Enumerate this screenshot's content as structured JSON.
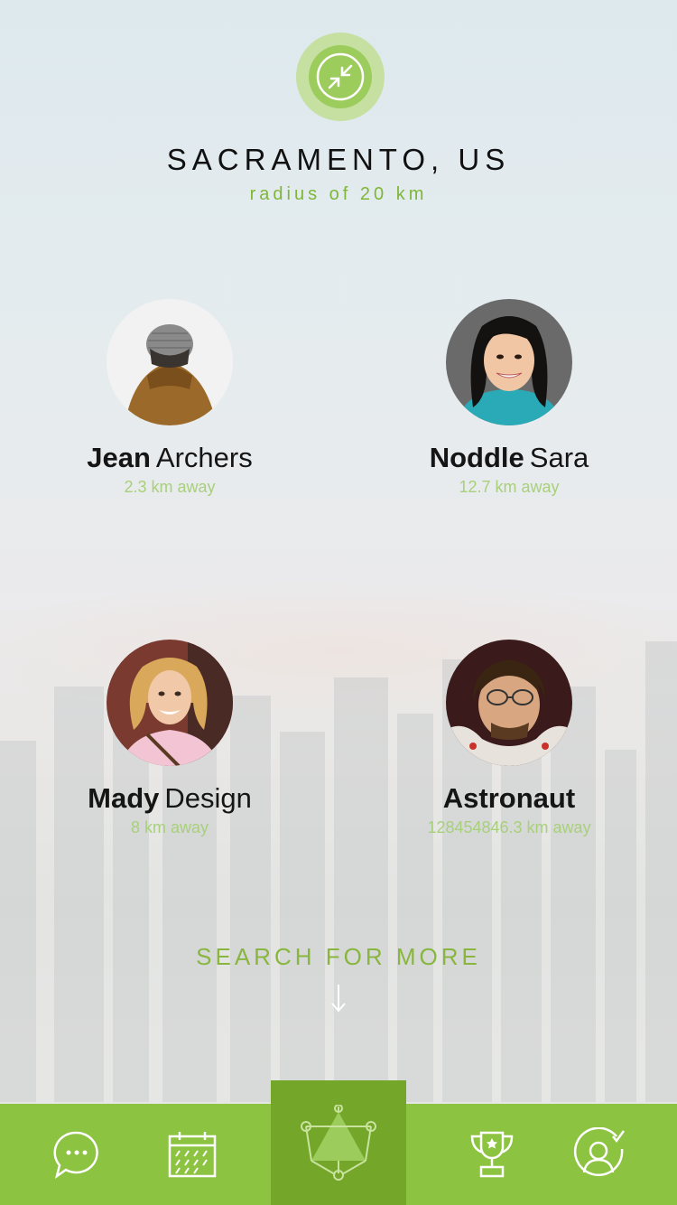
{
  "location": {
    "city": "SACRAMENTO, US",
    "radius": "radius of 20 km"
  },
  "people": [
    {
      "first": "Jean",
      "last": "Archers",
      "distance": "2.3 km away"
    },
    {
      "first": "Noddle",
      "last": "Sara",
      "distance": "12.7 km away"
    },
    {
      "first": "Mady",
      "last": "Design",
      "distance": "8 km away"
    },
    {
      "first": "Astronaut",
      "last": "",
      "distance": "128454846.3 km away"
    }
  ],
  "search_more": "SEARCH FOR MORE",
  "tabbar": {
    "items": [
      {
        "icon": "chat-bubble-icon"
      },
      {
        "icon": "calendar-icon"
      },
      {
        "icon": "network-triangle-icon",
        "active": true
      },
      {
        "icon": "trophy-icon"
      },
      {
        "icon": "user-check-icon"
      }
    ]
  },
  "colors": {
    "accent": "#8cc340",
    "accent_dark": "#74a62a",
    "distance_text": "#a8d07b"
  }
}
